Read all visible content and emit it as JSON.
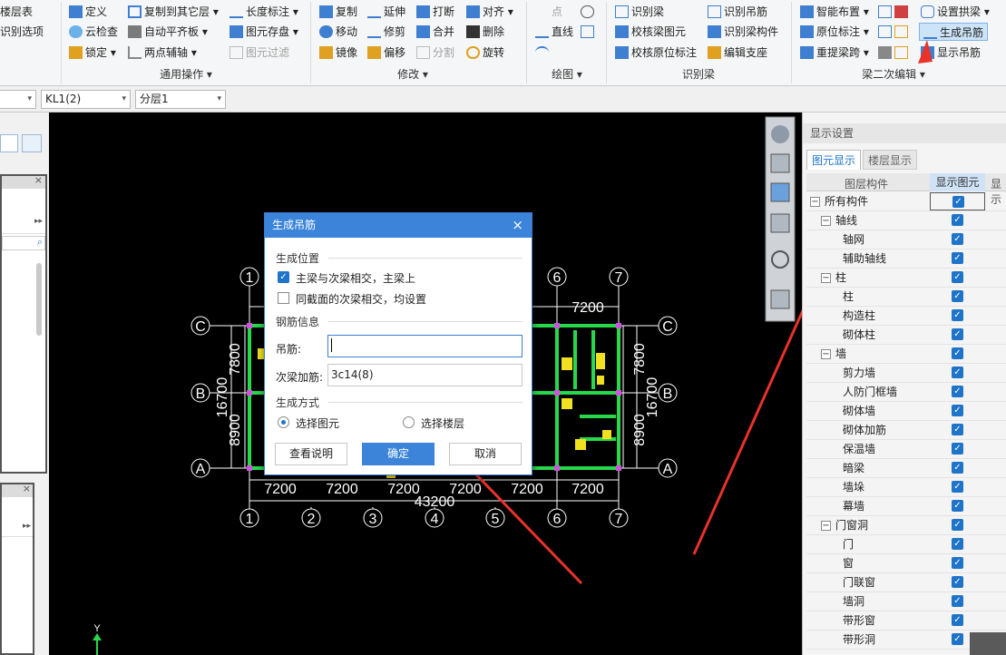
{
  "ribbon": {
    "col0": [
      "楼层表",
      "识别选项"
    ],
    "col1": [
      "定义",
      "云检查",
      "锁定"
    ],
    "col2": [
      "复制到其它层",
      "自动平齐板",
      "两点辅轴"
    ],
    "col3": [
      "长度标注",
      "图元存盘",
      "图元过滤"
    ],
    "group1": "通用操作",
    "modify_col1": [
      "复制",
      "移动",
      "镜像"
    ],
    "modify_col2": [
      "延伸",
      "修剪",
      "偏移"
    ],
    "modify_col3": [
      "打断",
      "合并",
      "分割"
    ],
    "modify_col4": [
      "对齐",
      "删除",
      "旋转"
    ],
    "group2": "修改",
    "draw": [
      "点",
      "直线"
    ],
    "group3": "绘图",
    "recog_col1": [
      "识别梁",
      "校核梁图元",
      "校核原位标注"
    ],
    "recog_col2": [
      "识别吊筋",
      "识别梁构件",
      "编辑支座"
    ],
    "group4": "识别梁",
    "sec_col1": [
      "智能布置",
      "原位标注",
      "重提梁跨"
    ],
    "sec_col2": [
      "设置拱梁",
      "生成吊筋",
      "显示吊筋"
    ],
    "group5": "梁二次编辑"
  },
  "combos": {
    "element": "KL1(2)",
    "layer": "分层1"
  },
  "dialog": {
    "title": "生成吊筋",
    "sec_position": "生成位置",
    "opt1": "主梁与次梁相交，主梁上",
    "opt2": "同截面的次梁相交，均设置",
    "sec_rebar": "钢筋信息",
    "hanger_label": "吊筋:",
    "hanger_value": "",
    "secondary_label": "次梁加筋:",
    "secondary_value": "3c14(8)",
    "sec_method": "生成方式",
    "radio1": "选择图元",
    "radio2": "选择楼层",
    "btn_help": "查看说明",
    "btn_ok": "确定",
    "btn_cancel": "取消"
  },
  "drawing": {
    "axis_top": [
      "1",
      "6",
      "7"
    ],
    "axis_bottom": [
      "1",
      "2",
      "3",
      "4",
      "5",
      "6",
      "7"
    ],
    "axis_letters": [
      "C",
      "B",
      "A"
    ],
    "dim_top": [
      "7200"
    ],
    "dim_bottom": [
      "7200",
      "7200",
      "7200",
      "7200",
      "7200",
      "7200"
    ],
    "dim_total": "43200",
    "dim_left_big": "16700",
    "dim_left_top": "7800",
    "dim_left_bot": "8900",
    "dim_right_big": "16700",
    "dim_right_top": "7800",
    "dim_right_bot": "8900",
    "y_axis": "Y"
  },
  "right_panel": {
    "title": "显示设置",
    "tabs": [
      "图元显示",
      "楼层显示"
    ],
    "col_headers": [
      "图层构件",
      "显示图元",
      "显示"
    ],
    "rows": [
      {
        "label": "所有构件",
        "level": 0,
        "toggle": "−"
      },
      {
        "label": "轴线",
        "level": 1,
        "toggle": "−"
      },
      {
        "label": "轴网",
        "level": 2
      },
      {
        "label": "辅助轴线",
        "level": 2
      },
      {
        "label": "柱",
        "level": 1,
        "toggle": "−"
      },
      {
        "label": "柱",
        "level": 2
      },
      {
        "label": "构造柱",
        "level": 2
      },
      {
        "label": "砌体柱",
        "level": 2
      },
      {
        "label": "墙",
        "level": 1,
        "toggle": "−"
      },
      {
        "label": "剪力墙",
        "level": 2
      },
      {
        "label": "人防门框墙",
        "level": 2
      },
      {
        "label": "砌体墙",
        "level": 2
      },
      {
        "label": "砌体加筋",
        "level": 2
      },
      {
        "label": "保温墙",
        "level": 2
      },
      {
        "label": "暗梁",
        "level": 2
      },
      {
        "label": "墙垛",
        "level": 2
      },
      {
        "label": "幕墙",
        "level": 2
      },
      {
        "label": "门窗洞",
        "level": 1,
        "toggle": "−"
      },
      {
        "label": "门",
        "level": 2
      },
      {
        "label": "窗",
        "level": 2
      },
      {
        "label": "门联窗",
        "level": 2
      },
      {
        "label": "墙洞",
        "level": 2
      },
      {
        "label": "带形窗",
        "level": 2
      },
      {
        "label": "带形洞",
        "level": 2
      }
    ]
  },
  "colors": {
    "accent": "#3c84d9",
    "beam": "#27d84a",
    "axis": "#ffffff",
    "arrow": "#e8322a"
  }
}
